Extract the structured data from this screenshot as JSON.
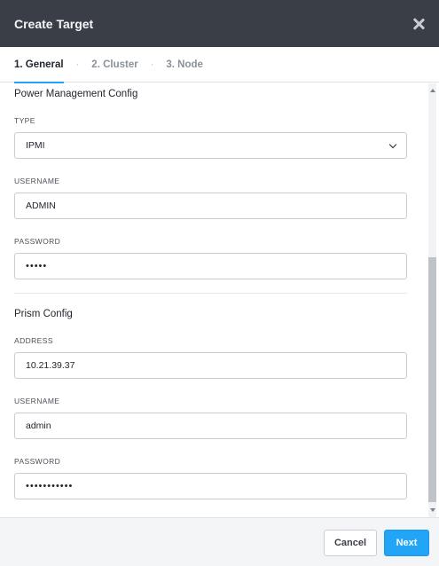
{
  "dialog": {
    "title": "Create Target"
  },
  "tabs": [
    {
      "label": "1. General",
      "active": true
    },
    {
      "label": "2. Cluster",
      "active": false
    },
    {
      "label": "3. Node",
      "active": false
    }
  ],
  "tab_separator": "·",
  "power_management": {
    "section_title": "Power Management Config",
    "type_label": "TYPE",
    "type_value": "IPMI",
    "username_label": "USERNAME",
    "username_value": "ADMIN",
    "password_label": "PASSWORD",
    "password_value": "•••••"
  },
  "prism": {
    "section_title": "Prism Config",
    "address_label": "ADDRESS",
    "address_value": "10.21.39.37",
    "username_label": "USERNAME",
    "username_value": "admin",
    "password_label": "PASSWORD",
    "password_value": "•••••••••••"
  },
  "footer": {
    "cancel_label": "Cancel",
    "next_label": "Next"
  },
  "colors": {
    "header_bg": "#3a3f47",
    "accent": "#22a5f7"
  }
}
